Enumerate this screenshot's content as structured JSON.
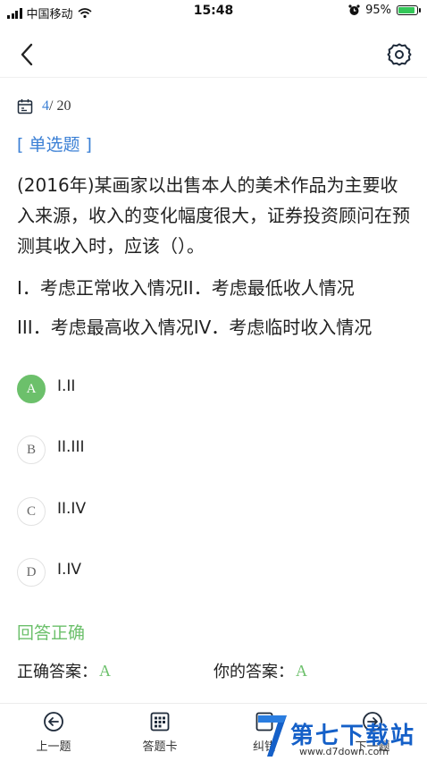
{
  "status_bar": {
    "carrier": "中国移动",
    "time": "15:48",
    "battery_pct": "95%",
    "battery_level": 0.95,
    "battery_color": "#34c759"
  },
  "nav": {
    "back_icon": "chevron-left-icon",
    "settings_icon": "gear-icon"
  },
  "progress": {
    "current": "4",
    "total": "/ 20",
    "icon": "calendar-icon"
  },
  "question": {
    "type_label": "[ 单选题 ]",
    "text": "(2016年)某画家以出售本人的美术作品为主要收入来源，收入的变化幅度很大，证券投资顾问在预测其收入时，应该（）。",
    "statement_1": "I．考虑正常收入情况II．考虑最低收人情况",
    "statement_2": "III．考虑最高收入情况IV．考虑临时收入情况"
  },
  "options": [
    {
      "letter": "A",
      "text": "I.II",
      "selected": true
    },
    {
      "letter": "B",
      "text": "II.III",
      "selected": false
    },
    {
      "letter": "C",
      "text": "II.IV",
      "selected": false
    },
    {
      "letter": "D",
      "text": "I.IV",
      "selected": false
    }
  ],
  "result": {
    "status": "回答正确",
    "correct_label": "正确答案：",
    "correct_value": "A",
    "yours_label": "你的答案：",
    "yours_value": "A"
  },
  "tabbar": [
    {
      "label": "上一题",
      "icon": "arrow-left-circle-icon"
    },
    {
      "label": "答题卡",
      "icon": "answer-card-icon"
    },
    {
      "label": "纠错",
      "icon": "report-error-icon"
    },
    {
      "label": "下一题",
      "icon": "arrow-right-circle-icon"
    }
  ],
  "watermark": {
    "text": "第七下载站",
    "url": "www.d7down.com"
  },
  "colors": {
    "accent_blue": "#3a7fd5",
    "correct_green": "#6cc06b",
    "watermark_blue": "#1560c8"
  }
}
